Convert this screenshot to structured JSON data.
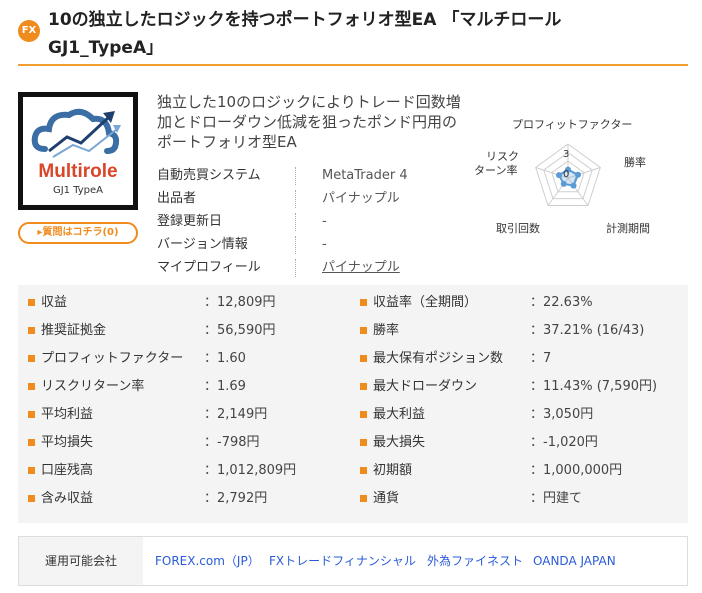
{
  "header": {
    "badge": "FX",
    "title": "10の独立したロジックを持つポートフォリオ型EA 「マルチロール GJ1_TypeA」"
  },
  "logo": {
    "name": "Multirole",
    "sub": "GJ1 TypeA"
  },
  "question_button": "質問はコチラ(0)",
  "description": "独立した10のロジックによりトレード回数増加とドローダウン低減を狙ったポンド円用のポートフォリオ型EA",
  "info": [
    {
      "label": "自動売買システム",
      "value": "MetaTrader 4"
    },
    {
      "label": "出品者",
      "value": "パイナップル"
    },
    {
      "label": "登録更新日",
      "value": "-"
    },
    {
      "label": "バージョン情報",
      "value": "-"
    },
    {
      "label": "マイプロフィール",
      "value": "パイナップル"
    }
  ],
  "radar": {
    "labels": {
      "profit_factor": "プロフィットファクター",
      "win_rate": "勝率",
      "period": "計測期間",
      "trades": "取引回数",
      "risk_return_1": "リスク",
      "risk_return_2": "ターン率"
    },
    "scale_3": "3",
    "scale_0": "0",
    "values": {
      "profit_factor": 0.4,
      "win_rate": 0.6,
      "period": 0.5,
      "trades": 0.3,
      "risk_return": 0.5
    },
    "max": 5,
    "color": "#5b9bd5"
  },
  "stats_left": [
    {
      "label": "収益",
      "value": "：12,809円"
    },
    {
      "label": "推奨証拠金",
      "value": "：56,590円"
    },
    {
      "label": "プロフィットファクター",
      "value": "：1.60"
    },
    {
      "label": "リスクリターン率",
      "value": "：1.69"
    },
    {
      "label": "平均利益",
      "value": "：2,149円"
    },
    {
      "label": "平均損失",
      "value": "：-798円"
    },
    {
      "label": "口座残高",
      "value": "：1,012,809円"
    },
    {
      "label": "含み収益",
      "value": "：2,792円"
    }
  ],
  "stats_right": [
    {
      "label": "収益率（全期間）",
      "value": "：22.63%"
    },
    {
      "label": "勝率",
      "value": "：37.21% (16/43)"
    },
    {
      "label": "最大保有ポジション数",
      "value": "：7"
    },
    {
      "label": "最大ドローダウン",
      "value": "：11.43% (7,590円)"
    },
    {
      "label": "最大利益",
      "value": "：3,050円"
    },
    {
      "label": "最大損失",
      "value": "：-1,020円"
    },
    {
      "label": "初期額",
      "value": "：1,000,000円"
    },
    {
      "label": "通貨",
      "value": "：円建て"
    }
  ],
  "companies": {
    "label": "運用可能会社",
    "items": [
      "FOREX.com（JP）",
      "FXトレードフィナンシャル",
      "外為ファイネスト",
      "OANDA JAPAN"
    ]
  },
  "colors": {
    "accent": "#f08c1e",
    "link": "#2a5bd7",
    "panel": "#f4f4f4"
  }
}
